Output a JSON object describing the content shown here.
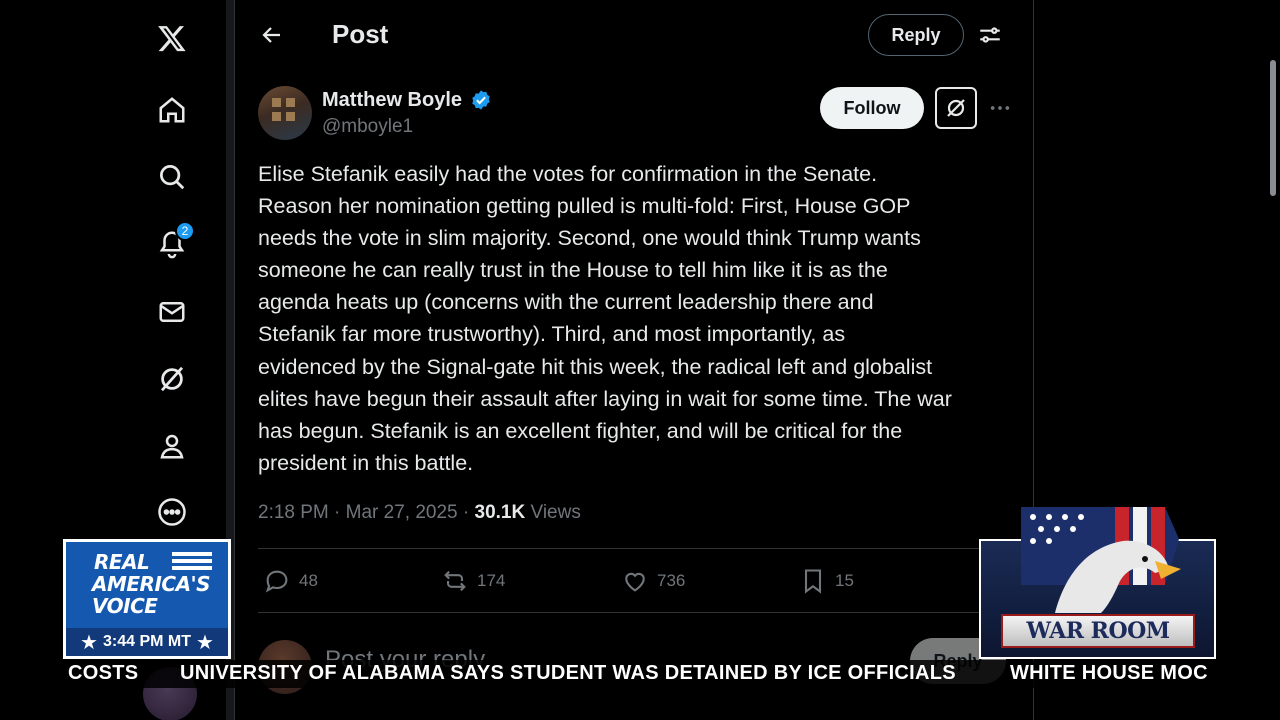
{
  "nav": {
    "items": [
      "x-logo",
      "home",
      "explore",
      "notifications",
      "messages",
      "grok",
      "profile",
      "more"
    ],
    "notifications_badge": "2"
  },
  "header": {
    "title": "Post",
    "reply_label": "Reply"
  },
  "post": {
    "author_name": "Matthew Boyle",
    "author_handle": "@mboyle1",
    "follow_label": "Follow",
    "text_lines": [
      "Elise Stefanik easily had the votes for confirmation in the Senate.",
      "Reason her nomination getting pulled is multi-fold: First, House GOP",
      "needs the vote in slim majority. Second, one would think Trump wants",
      "someone he can really trust in the House to tell him like it is as the",
      "agenda heats up (concerns with the current leadership there and",
      "Stefanik far more trustworthy). Third, and most importantly, as",
      "evidenced by the Signal-gate hit this week, the radical left and globalist",
      "elites have begun their assault after laying in wait for some time. The war",
      "has begun. Stefanik is an excellent fighter, and will be critical for the",
      "president in this battle."
    ],
    "time": "2:18 PM",
    "date": "Mar 27, 2025",
    "views_count": "30.1K",
    "views_label": "Views",
    "replies": "48",
    "reposts": "174",
    "likes": "736",
    "bookmarks": "15"
  },
  "reply_box": {
    "placeholder": "Post your reply",
    "button_label": "Reply"
  },
  "broadcast": {
    "network_line1": "REAL",
    "network_line2": "AMERICA'S",
    "network_line3": "VOICE",
    "time": "3:44 PM MT",
    "show_name": "WAR ROOM",
    "ticker_left": "COSTS",
    "ticker_main": "UNIVERSITY OF ALABAMA SAYS STUDENT WAS DETAINED BY ICE OFFICIALS",
    "ticker_right": "WHITE HOUSE MOC"
  },
  "colors": {
    "accent": "#1d9bf0",
    "background": "#000000",
    "text": "#e7e9ea",
    "muted": "#71767b",
    "broadcast_blue": "#1558b0"
  }
}
